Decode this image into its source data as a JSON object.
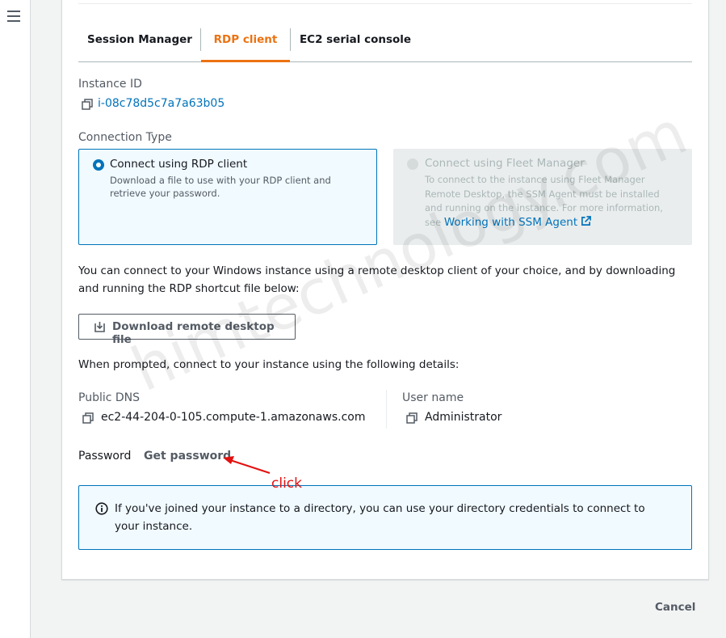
{
  "tabs": [
    {
      "label": "Session Manager",
      "active": false
    },
    {
      "label": "RDP client",
      "active": true
    },
    {
      "label": "EC2 serial console",
      "active": false
    }
  ],
  "instance": {
    "label": "Instance ID",
    "id": "i-08c78d5c7a7a63b05"
  },
  "connection": {
    "label": "Connection Type",
    "options": [
      {
        "title": "Connect using RDP client",
        "description": "Download a file to use with your RDP client and retrieve your password.",
        "selected": true
      },
      {
        "title": "Connect using Fleet Manager",
        "description": "To connect to the instance using Fleet Manager Remote Desktop, the SSM Agent must be installed and running on the instance. For more information, see",
        "link": "Working with SSM Agent",
        "selected": false,
        "disabled": true
      }
    ]
  },
  "intro": "You can connect to your Windows instance using a remote desktop client of your choice, and by downloading and running the RDP shortcut file below:",
  "download_button": "Download remote desktop file",
  "prompt_text": "When prompted, connect to your instance using the following details:",
  "details": {
    "dns_label": "Public DNS",
    "dns_value": "ec2-44-204-0-105.compute-1.amazonaws.com",
    "user_label": "User name",
    "user_value": "Administrator",
    "password_label": "Password",
    "get_password": "Get password"
  },
  "info": "If you've joined your instance to a directory, you can use your directory credentials to connect to your instance.",
  "cancel": "Cancel",
  "annotation": "click",
  "watermark": "himtechnology.com",
  "colors": {
    "accent": "#ec7211",
    "link": "#0073bb",
    "annotation": "#e31010"
  }
}
